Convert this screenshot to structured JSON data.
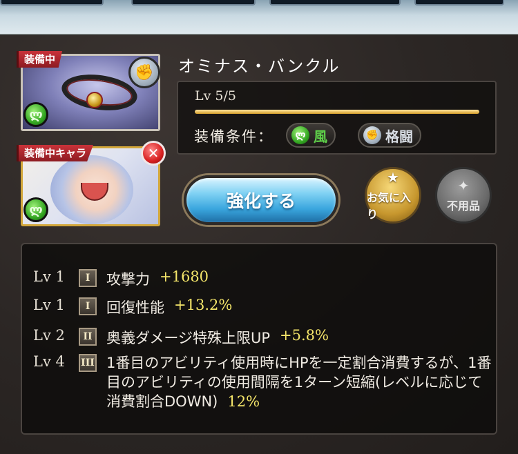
{
  "item": {
    "name": "オミナス・バンクル",
    "equipped_ribbon": "装備中",
    "equipped_char_ribbon": "装備中キャラ",
    "slot_icon": "gauntlet-icon",
    "element_icon": "wind-element-icon"
  },
  "level": {
    "label": "Lv 5/5",
    "current": 5,
    "max": 5
  },
  "conditions": {
    "label": "装備条件：",
    "element": "風",
    "weapon_type": "格闘"
  },
  "buttons": {
    "enhance": "強化する",
    "favorite": "お気に入り",
    "junk": "不用品"
  },
  "colors": {
    "accent_gold": "#f5e66a",
    "enhance_blue": "#3aa6de",
    "ribbon_red": "#c9333a"
  },
  "skills": [
    {
      "lv": "Lv 1",
      "tier": "I",
      "name": "攻撃力",
      "value": "+1680"
    },
    {
      "lv": "Lv 1",
      "tier": "I",
      "name": "回復性能",
      "value": "+13.2%"
    },
    {
      "lv": "Lv 2",
      "tier": "II",
      "name": "奥義ダメージ特殊上限UP",
      "value": "+5.8%"
    },
    {
      "lv": "Lv 4",
      "tier": "III",
      "name": "1番目のアビリティ使用時にHPを一定割合消費するが、1番目のアビリティの使用間隔を1ターン短縮(レベルに応じて消費割合DOWN)",
      "value": "12%"
    }
  ]
}
